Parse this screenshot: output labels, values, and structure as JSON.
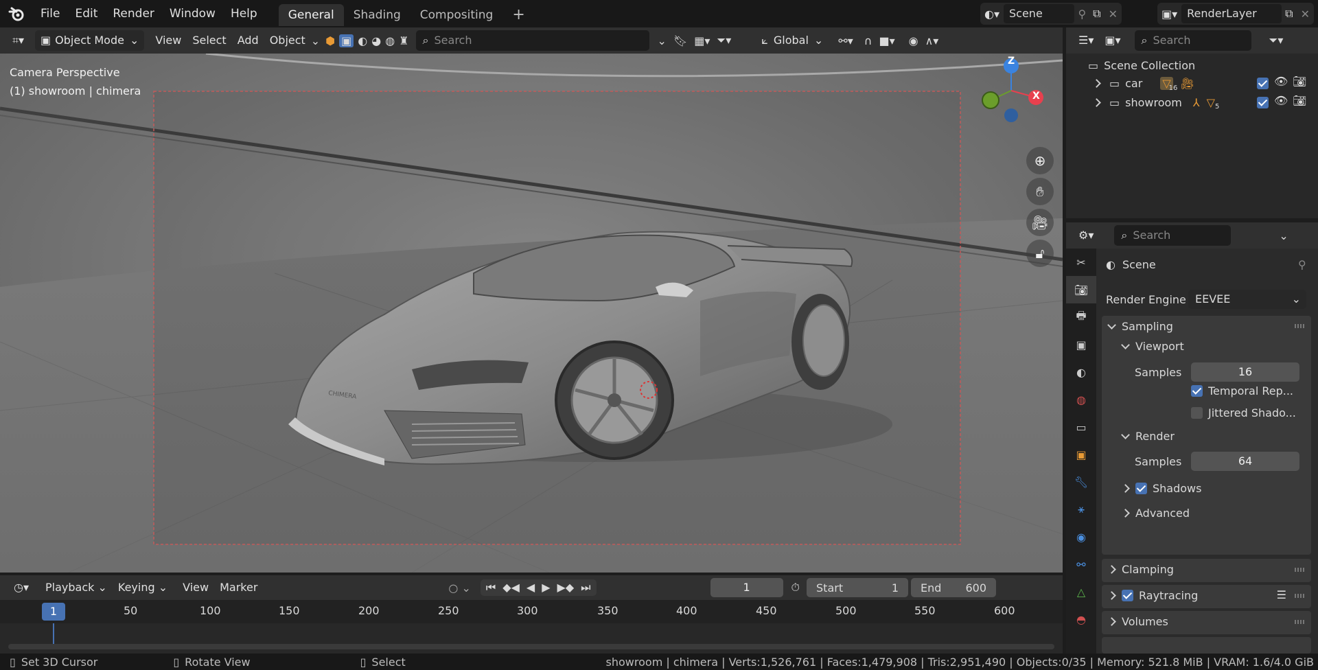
{
  "topbar": {
    "menus": [
      "File",
      "Edit",
      "Render",
      "Window",
      "Help"
    ],
    "workspace_tabs": [
      "General",
      "Shading",
      "Compositing"
    ],
    "scene_name": "Scene",
    "view_layer": "RenderLayer"
  },
  "viewport_header": {
    "mode": "Object Mode",
    "menus": [
      "View",
      "Select",
      "Add",
      "Object"
    ],
    "search_placeholder": "Search",
    "transform_orientation": "Global"
  },
  "viewport": {
    "overlay_line1": "Camera Perspective",
    "overlay_line2": "(1) showroom | chimera",
    "car_badge": "CHIMERA",
    "axes": {
      "z": "Z",
      "x": "X"
    }
  },
  "outliner": {
    "search_placeholder": "Search",
    "root": "Scene Collection",
    "items": [
      {
        "name": "car",
        "badge": "16"
      },
      {
        "name": "showroom",
        "badge": "5"
      }
    ]
  },
  "properties": {
    "search_placeholder": "Search",
    "context": "Scene",
    "render_engine_label": "Render Engine",
    "render_engine_value": "EEVEE",
    "sampling": {
      "title": "Sampling",
      "viewport": {
        "title": "Viewport",
        "samples_label": "Samples",
        "samples": "16",
        "temporal": "Temporal Rep...",
        "jittered": "Jittered Shado..."
      },
      "render": {
        "title": "Render",
        "samples_label": "Samples",
        "samples": "64",
        "shadows": "Shadows",
        "advanced": "Advanced"
      }
    },
    "panels": [
      "Clamping",
      "Raytracing",
      "Volumes"
    ]
  },
  "timeline": {
    "menus": [
      "Playback",
      "Keying",
      "View",
      "Marker"
    ],
    "current_frame": "1",
    "start_label": "Start",
    "start": "1",
    "end_label": "End",
    "end": "600",
    "ruler": [
      "50",
      "100",
      "150",
      "200",
      "250",
      "300",
      "350",
      "400",
      "450",
      "500",
      "550",
      "600"
    ],
    "playhead": "1"
  },
  "statusbar": {
    "hint_left": "Set 3D Cursor",
    "hint_mid": "Rotate View",
    "hint_right": "Select",
    "stats": "showroom | chimera | Verts:1,526,761 | Faces:1,479,908 | Tris:2,951,490 | Objects:0/35 | Memory: 521.8 MiB | VRAM: 1.6/4.0 GiB"
  },
  "colors": {
    "accent": "#4772b3",
    "axis_x": "#e8404e",
    "axis_y": "#6b9e2b",
    "axis_z": "#3a83e0",
    "viewport_bg": "#7e7e7e"
  }
}
